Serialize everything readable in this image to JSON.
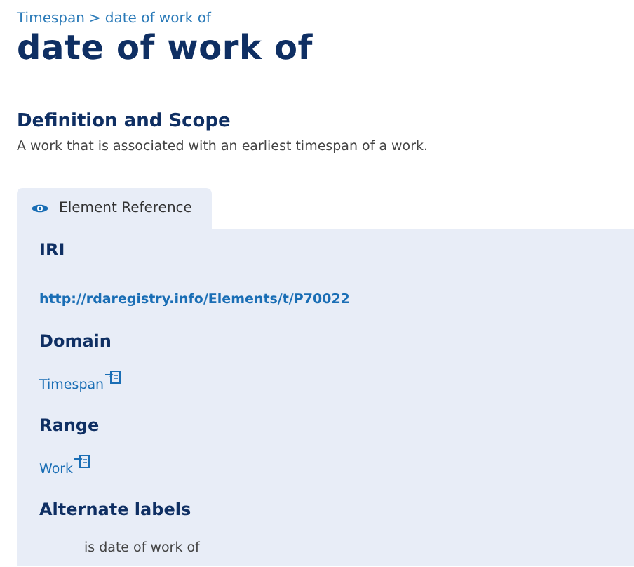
{
  "breadcrumb": {
    "links": [
      {
        "label": "Timespan"
      }
    ],
    "separator": ">",
    "current": "date of work of"
  },
  "title": "date of work of",
  "definition": {
    "heading": "Definition and Scope",
    "text": "A work that is associated with an earliest timespan of a work."
  },
  "tabs": [
    {
      "label": "Element Reference",
      "selected": true
    }
  ],
  "sections": [
    {
      "heading": "IRI",
      "kind": "link",
      "value": "http://rdaregistry.info/Elements/t/P70022"
    },
    {
      "heading": "Domain",
      "kind": "ref",
      "value": "Timespan"
    },
    {
      "heading": "Range",
      "kind": "ref",
      "value": "Work"
    },
    {
      "heading": "Alternate labels",
      "kind": "list",
      "value": "is date of work of"
    }
  ]
}
